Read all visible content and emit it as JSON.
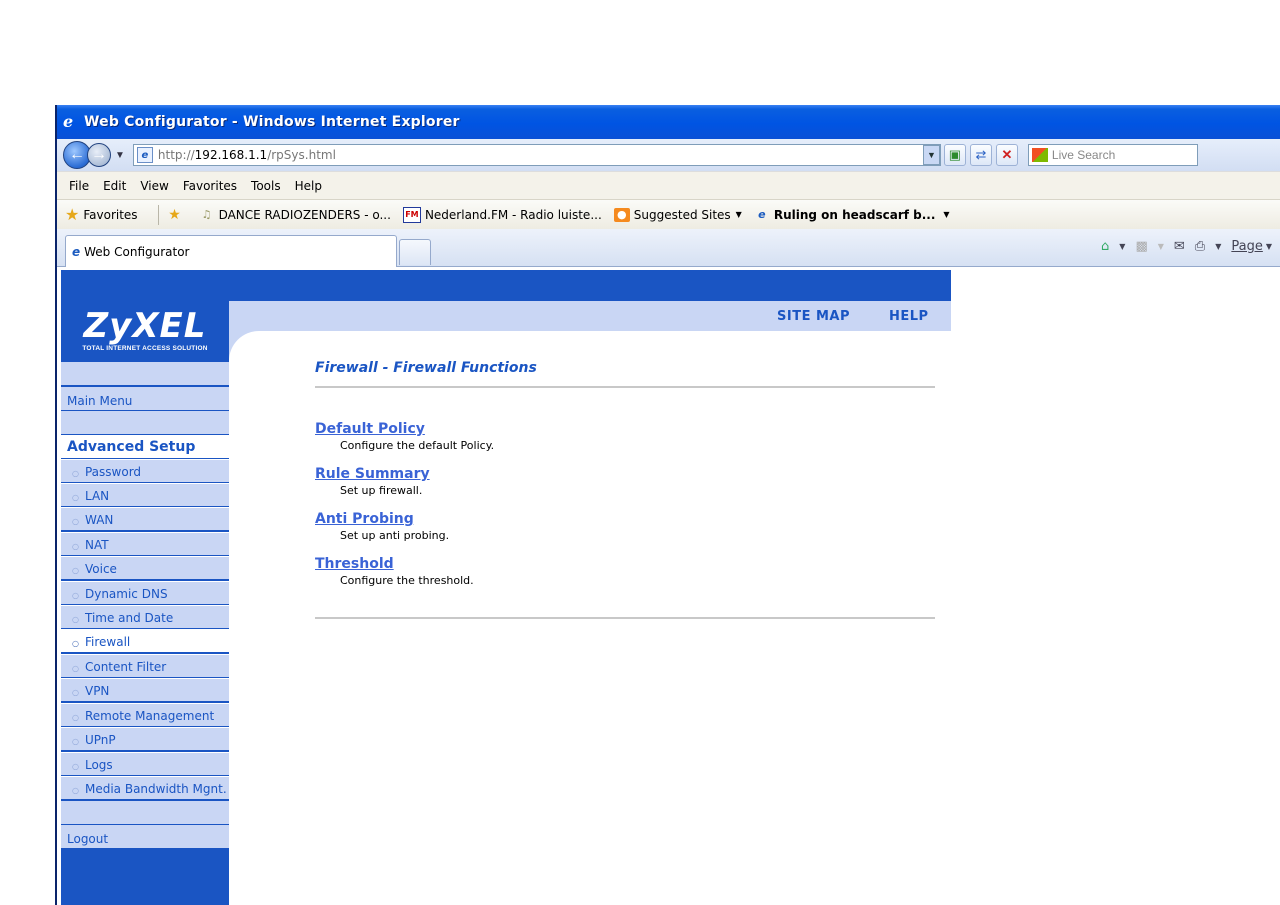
{
  "window": {
    "title": "Web Configurator - Windows Internet Explorer"
  },
  "address": {
    "prefix": "http://",
    "host": "192.168.1.1",
    "path": "/rpSys.html",
    "search_placeholder": "Live Search"
  },
  "menu": [
    "File",
    "Edit",
    "View",
    "Favorites",
    "Tools",
    "Help"
  ],
  "favorites": {
    "label": "Favorites",
    "items": [
      {
        "label": "DANCE RADIOZENDERS - o..."
      },
      {
        "label": "Nederland.FM - Radio luiste..."
      },
      {
        "label": "Suggested Sites"
      },
      {
        "label": "Ruling on headscarf b..."
      }
    ]
  },
  "tab": {
    "label": "Web Configurator"
  },
  "commandbar": {
    "page_label": "Page"
  },
  "zyxel": {
    "brand": "ZyXEL",
    "tagline": "TOTAL INTERNET ACCESS SOLUTION",
    "site_map": "SITE MAP",
    "help": "HELP"
  },
  "sidebar": {
    "main_menu": "Main Menu",
    "heading": "Advanced Setup",
    "items": [
      "Password",
      "LAN",
      "WAN",
      "NAT",
      "Voice",
      "Dynamic DNS",
      "Time and Date",
      "Firewall",
      "Content Filter",
      "VPN",
      "Remote Management",
      "UPnP",
      "Logs",
      "Media Bandwidth Mgnt."
    ],
    "active": "Firewall",
    "logout": "Logout"
  },
  "main": {
    "title": "Firewall - Firewall Functions",
    "sections": [
      {
        "link": "Default Policy",
        "desc": "Configure the default Policy."
      },
      {
        "link": "Rule Summary",
        "desc": "Set up firewall."
      },
      {
        "link": "Anti Probing",
        "desc": "Set up anti probing."
      },
      {
        "link": "Threshold",
        "desc": "Configure the threshold."
      }
    ]
  }
}
